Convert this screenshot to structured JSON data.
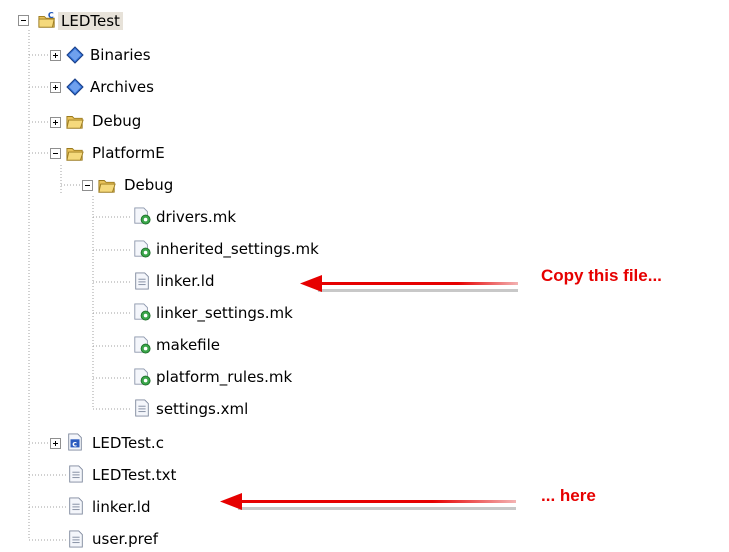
{
  "tree": {
    "project": {
      "label": "LEDTest",
      "icon": "c-project-folder-icon",
      "expanded": true
    },
    "items": [
      {
        "id": "binaries",
        "label": "Binaries",
        "icon": "binaries-icon",
        "toggle": "plus"
      },
      {
        "id": "archives",
        "label": "Archives",
        "icon": "archives-icon",
        "toggle": "plus"
      },
      {
        "id": "debug",
        "label": "Debug",
        "icon": "folder-icon",
        "toggle": "plus"
      },
      {
        "id": "platforme",
        "label": "PlatformE",
        "icon": "folder-icon",
        "toggle": "minus"
      },
      {
        "id": "platforme-debug",
        "label": "Debug",
        "icon": "folder-icon",
        "toggle": "minus"
      },
      {
        "id": "drivers-mk",
        "label": "drivers.mk",
        "icon": "makefile-icon"
      },
      {
        "id": "inherited-settings-mk",
        "label": "inherited_settings.mk",
        "icon": "makefile-icon"
      },
      {
        "id": "linker-ld-debug",
        "label": "linker.ld",
        "icon": "text-file-icon"
      },
      {
        "id": "linker-settings-mk",
        "label": "linker_settings.mk",
        "icon": "makefile-icon"
      },
      {
        "id": "makefile",
        "label": "makefile",
        "icon": "makefile-icon"
      },
      {
        "id": "platform-rules-mk",
        "label": "platform_rules.mk",
        "icon": "makefile-icon"
      },
      {
        "id": "settings-xml",
        "label": "settings.xml",
        "icon": "text-file-icon"
      },
      {
        "id": "ledtest-c",
        "label": "LEDTest.c",
        "icon": "c-source-file-icon",
        "toggle": "plus"
      },
      {
        "id": "ledtest-txt",
        "label": "LEDTest.txt",
        "icon": "text-file-icon"
      },
      {
        "id": "linker-ld-root",
        "label": "linker.ld",
        "icon": "text-file-icon"
      },
      {
        "id": "user-pref",
        "label": "user.pref",
        "icon": "text-file-icon"
      }
    ]
  },
  "annotations": {
    "copy_from": "Copy this file...",
    "copy_to": "... here",
    "arrow_color": "#e60000"
  },
  "colors": {
    "folder": "#e8c25a",
    "diamond": "#2f6fd6",
    "tree_line": "#a0a0a0",
    "selection": "#e7e2d9"
  }
}
